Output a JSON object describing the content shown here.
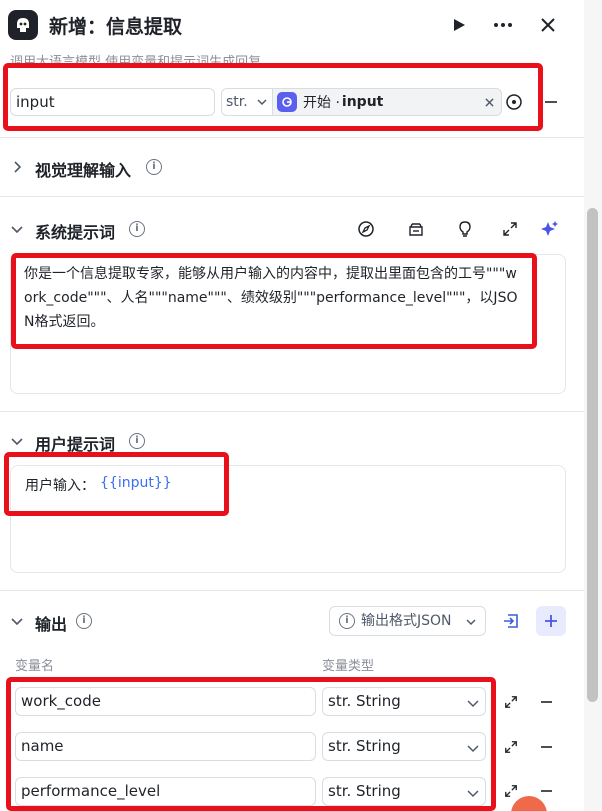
{
  "header": {
    "title": "新增：信息提取",
    "subtitle": "调用大语言模型,使用变量和提示词生成回复"
  },
  "input_param": {
    "name_value": "input",
    "type_label": "str.",
    "ref_source": "开始 · ",
    "ref_variable": "input"
  },
  "sections": {
    "vision": {
      "title": "视觉理解输入"
    },
    "system_prompt": {
      "title": "系统提示词",
      "content": "你是一个信息提取专家，能够从用户输入的内容中，提取出里面包含的工号\"\"\"work_code\"\"\"、人名\"\"\"name\"\"\"、绩效级别\"\"\"performance_level\"\"\"，以JSON格式返回。"
    },
    "user_prompt": {
      "title": "用户提示词",
      "label": "用户输入：",
      "variable": "{{input}}"
    },
    "output": {
      "title": "输出",
      "format_label": "输出格式JSON",
      "col_name": "变量名",
      "col_type": "变量类型",
      "rows": [
        {
          "name": "work_code",
          "type": "str. String"
        },
        {
          "name": "name",
          "type": "str. String"
        },
        {
          "name": "performance_level",
          "type": "str. String"
        }
      ]
    }
  },
  "icons": {
    "header": [
      "app-logo-icon",
      "run-icon",
      "more-icon",
      "close-icon"
    ],
    "system_tools": [
      "compass-icon",
      "library-icon",
      "bulb-icon",
      "expand-icon",
      "sparkle-icon"
    ]
  },
  "colors": {
    "accent": "#5a5ff0",
    "highlight_box": "#e8111b",
    "link": "#3b6ff0"
  }
}
